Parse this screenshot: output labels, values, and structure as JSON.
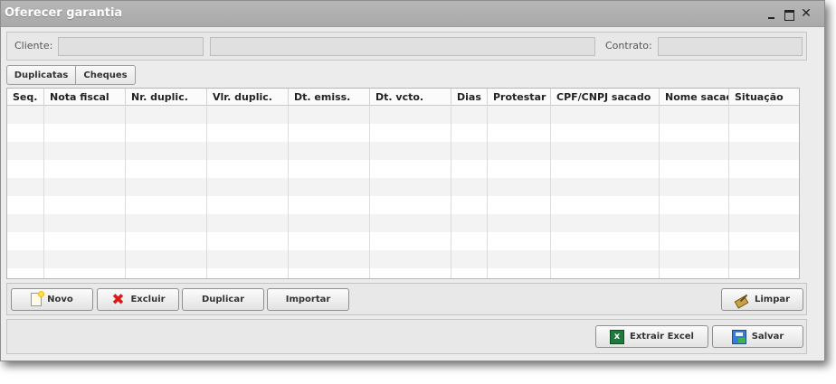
{
  "window": {
    "title": "Oferecer garantia"
  },
  "header": {
    "cliente_label": "Cliente:",
    "cliente_code": "",
    "cliente_name": "",
    "contrato_label": "Contrato:",
    "contrato_value": ""
  },
  "tabs": [
    {
      "label": "Duplicatas",
      "active": true
    },
    {
      "label": "Cheques",
      "active": false
    }
  ],
  "grid": {
    "columns": [
      "Seq.",
      "Nota fiscal",
      "Nr. duplic.",
      "Vlr. duplic.",
      "Dt. emiss.",
      "Dt. vcto.",
      "Dias",
      "Protestar",
      "CPF/CNPJ sacado",
      "Nome sacado",
      "Situação"
    ],
    "rows": []
  },
  "actions": {
    "novo": "Novo",
    "excluir": "Excluir",
    "duplicar": "Duplicar",
    "importar": "Importar",
    "limpar": "Limpar"
  },
  "footer": {
    "extrair_excel": "Extrair Excel",
    "salvar": "Salvar"
  },
  "icons": {
    "novo": "new-document-icon",
    "excluir": "delete-x-icon",
    "limpar": "broom-icon",
    "extrair_excel": "excel-icon",
    "salvar": "save-icon"
  }
}
